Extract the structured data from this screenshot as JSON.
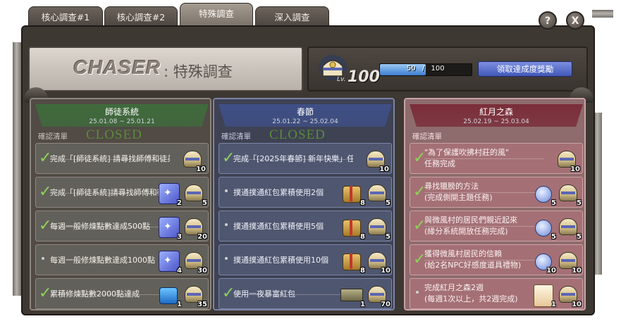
{
  "tabs": [
    {
      "label": "核心調查#1"
    },
    {
      "label": "核心調查#2"
    },
    {
      "label": "特殊調查"
    },
    {
      "label": "深入調查"
    }
  ],
  "buttons": {
    "help": "?",
    "close": "X"
  },
  "header": {
    "logo": "CHASER",
    "title": ": 特殊調查",
    "level_prefix": "Lv.",
    "level": "100",
    "progress_current": "50",
    "progress_sep": "/",
    "progress_max": "100",
    "progress_fraction": 0.5,
    "claim_button": "領取達成度獎勵"
  },
  "columns": [
    {
      "title": "師徒系統",
      "dates": "25.01.08 ~ 25.01.21",
      "checklist_label": "確認清單",
      "closed": "CLOSED",
      "theme": "green",
      "rows": [
        {
          "done": true,
          "text": "完成「[師徒系統] 請尋找師傅和徒弟」任務",
          "icons": [
            {
              "type": "chest",
              "count": "10"
            }
          ]
        },
        {
          "done": true,
          "text": "完成「[師徒系統]請尋找師傅和徒",
          "icons": [
            {
              "type": "scroll",
              "count": "2"
            },
            {
              "type": "chest",
              "count": "5"
            }
          ]
        },
        {
          "done": true,
          "text": "每週一般修煉點數達成500點",
          "icons": [
            {
              "type": "scroll",
              "count": "3"
            },
            {
              "type": "chest",
              "count": "20"
            }
          ]
        },
        {
          "done": false,
          "text": "每週一般修煉點數達成1000點",
          "icons": [
            {
              "type": "scroll",
              "count": "4"
            },
            {
              "type": "chest",
              "count": "30"
            }
          ]
        },
        {
          "done": true,
          "text": "累積修煉點數2000點達成",
          "icons": [
            {
              "type": "blue",
              "count": "1"
            },
            {
              "type": "chest",
              "count": "35"
            }
          ]
        }
      ]
    },
    {
      "title": "春節",
      "dates": "25.01.22 ~ 25.02.04",
      "checklist_label": "確認清單",
      "closed": "CLOSED",
      "theme": "blue",
      "rows": [
        {
          "done": true,
          "text": "完成「[2025年春節] 新年快樂」任",
          "icons": [
            {
              "type": "chest",
              "count": "10"
            }
          ]
        },
        {
          "done": false,
          "text": "撲通撲通紅包累積使用2個",
          "icons": [
            {
              "type": "gift",
              "count": "8"
            },
            {
              "type": "chest",
              "count": "5"
            }
          ]
        },
        {
          "done": false,
          "text": "撲通撲通紅包累積使用5個",
          "icons": [
            {
              "type": "gift",
              "count": "8"
            },
            {
              "type": "chest",
              "count": "5"
            }
          ]
        },
        {
          "done": false,
          "text": "撲通撲通紅包累積使用10個",
          "icons": [
            {
              "type": "gift",
              "count": "8"
            },
            {
              "type": "chest",
              "count": "10"
            }
          ]
        },
        {
          "done": true,
          "text": "使用一夜暴富紅包",
          "icons": [
            {
              "type": "ticket",
              "count": "1"
            },
            {
              "type": "chest",
              "count": "70"
            }
          ]
        }
      ]
    },
    {
      "title": "紅月之森",
      "dates": "25.02.19 ~ 25.03.04",
      "checklist_label": "確認清單",
      "closed": "",
      "theme": "red",
      "rows": [
        {
          "done": true,
          "text": "\"為了保護吹拂村莊的風\"",
          "text2": "任務完成",
          "icons": [
            {
              "type": "chest",
              "count": "10"
            }
          ]
        },
        {
          "done": true,
          "text": "尋找獵膀的方法",
          "text2": "(完成側開主題任務)",
          "icons": [
            {
              "type": "orb",
              "count": "5"
            },
            {
              "type": "chest",
              "count": "5"
            }
          ]
        },
        {
          "done": true,
          "text": "與微風村的居民們親近起來",
          "text2": "(緣分系統開放任務完成)",
          "icons": [
            {
              "type": "orb",
              "count": "5"
            },
            {
              "type": "chest",
              "count": "5"
            }
          ]
        },
        {
          "done": true,
          "text": "獲得微風村居民的信賴",
          "text2": "(給2名NPC好感度道具禮物)",
          "icons": [
            {
              "type": "orb",
              "count": "10"
            },
            {
              "type": "chest",
              "count": "10"
            }
          ]
        },
        {
          "done": false,
          "text": "完成紅月之森2週",
          "text2": "(每週1次以上，共2週完成)",
          "icons": [
            {
              "type": "card",
              "count": "1"
            },
            {
              "type": "chest",
              "count": "10"
            }
          ]
        }
      ]
    }
  ],
  "colors": {
    "green": "#3f6b3c",
    "blue": "#3f4f86",
    "red": "#7a2d39",
    "check": "#86c35a"
  }
}
